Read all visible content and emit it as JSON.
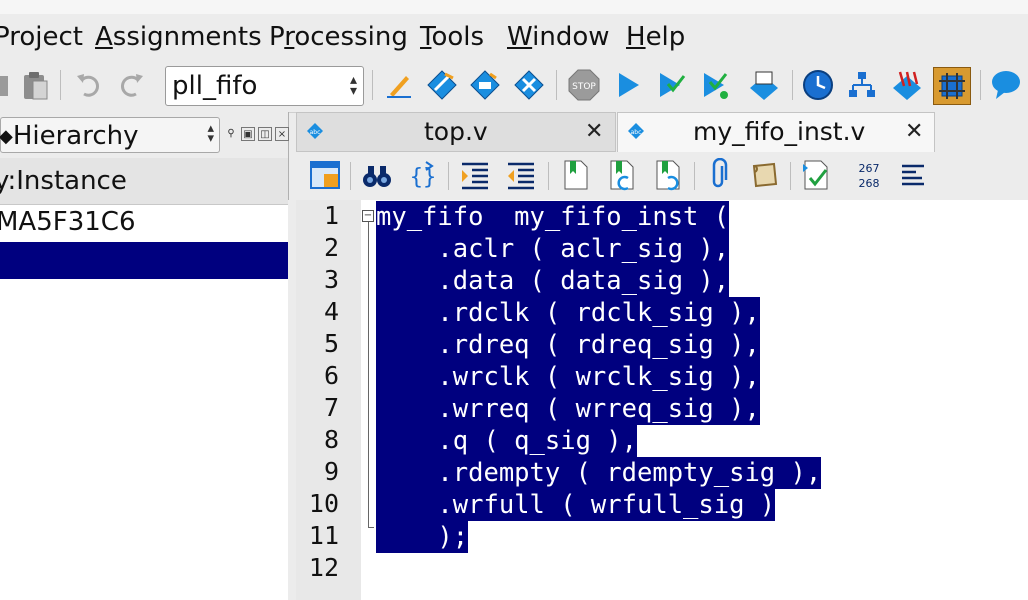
{
  "menu": [
    {
      "label": "Project",
      "ul": ""
    },
    {
      "label": "Assignments",
      "ul": "A"
    },
    {
      "label": "Processing",
      "ul": "r"
    },
    {
      "label": "Tools",
      "ul": "T"
    },
    {
      "label": "Window",
      "ul": "W"
    },
    {
      "label": "Help",
      "ul": "H"
    }
  ],
  "toolbar": {
    "project_combo": "pll_fifo",
    "icons": [
      "paste-icon",
      "undo-icon",
      "redo-icon",
      "edit-icon",
      "analysis-icon",
      "synthesis-icon",
      "fitter-icon",
      "stop-icon",
      "start-compilation-icon",
      "analysis-elaboration-icon",
      "timing-icon",
      "assembler-icon",
      "timequest-icon",
      "netlist-viewer-icon",
      "chip-planner-icon",
      "pin-planner-icon",
      "help-icon"
    ]
  },
  "left_panel": {
    "view_selector": "Hierarchy",
    "column_header": "y:Instance",
    "rows": [
      "MA5F31C6",
      ""
    ]
  },
  "tabs": [
    {
      "label": "top.v",
      "active": false
    },
    {
      "label": "my_fifo_inst.v",
      "active": true
    }
  ],
  "editor": {
    "line_numbers": [
      "1",
      "2",
      "3",
      "4",
      "5",
      "6",
      "7",
      "8",
      "9",
      "10",
      "11",
      "12"
    ],
    "lines": [
      "my_fifo  my_fifo_inst (",
      "    .aclr ( aclr_sig ),",
      "    .data ( data_sig ),",
      "    .rdclk ( rdclk_sig ),",
      "    .rdreq ( rdreq_sig ),",
      "    .wrclk ( wrclk_sig ),",
      "    .wrreq ( wrreq_sig ),",
      "    .q ( q_sig ),",
      "    .rdempty ( rdempty_sig ),",
      "    .wrfull ( wrfull_sig )",
      "    );",
      ""
    ],
    "selection_color": "#00007f",
    "line_number_label_top": "267",
    "line_number_label_bottom": "268"
  }
}
